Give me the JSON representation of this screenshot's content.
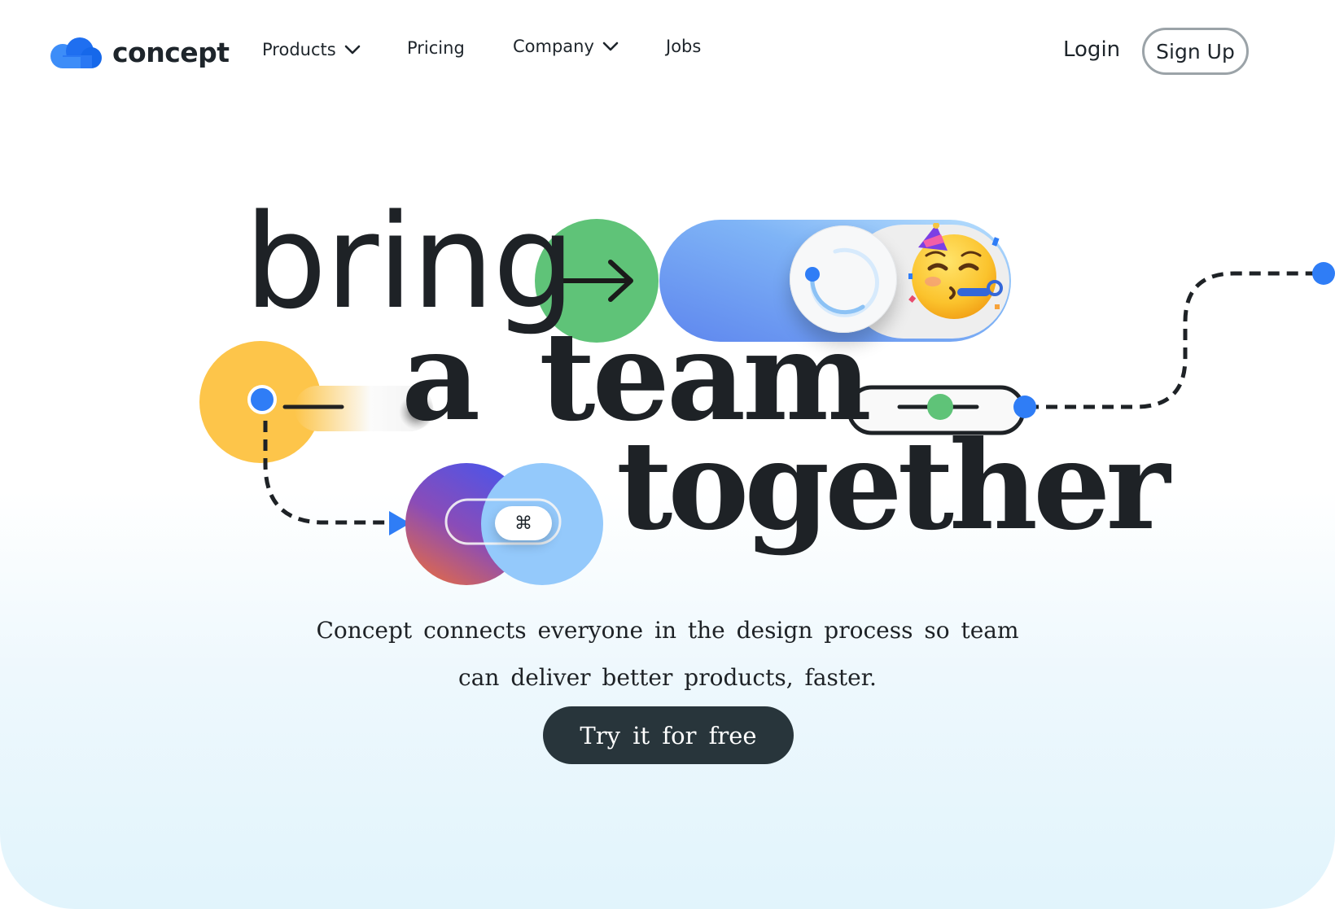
{
  "brand": {
    "name": "concept",
    "logo_icon": "cloud-icon",
    "logo_color": "#1a6ef5"
  },
  "nav": {
    "items": [
      {
        "label": "Products",
        "has_dropdown": true
      },
      {
        "label": "Pricing",
        "has_dropdown": false
      },
      {
        "label": "Company",
        "has_dropdown": true
      },
      {
        "label": "Jobs",
        "has_dropdown": false
      }
    ],
    "login_label": "Login",
    "signup_label": "Sign Up"
  },
  "hero": {
    "headline_words": [
      "bring",
      "a",
      "team",
      "together"
    ],
    "tagline_line1": "Concept connects everyone in the design process so team",
    "tagline_line2": "can deliver better products, faster.",
    "cta_label": "Try it for free",
    "command_key": "⌘",
    "decorations": {
      "icons": [
        "arrow-right-icon",
        "partying-face-emoji",
        "toggle-icon",
        "slider-icon",
        "command-key-icon"
      ],
      "colors": {
        "green": "#5fc378",
        "yellow": "#fdc54a",
        "blue_dot": "#2f7df6",
        "light_blue": "#94c9fb",
        "purple": "#5b4ee0",
        "dark_text": "#1e2226",
        "cta_bg": "#28353b"
      }
    }
  }
}
